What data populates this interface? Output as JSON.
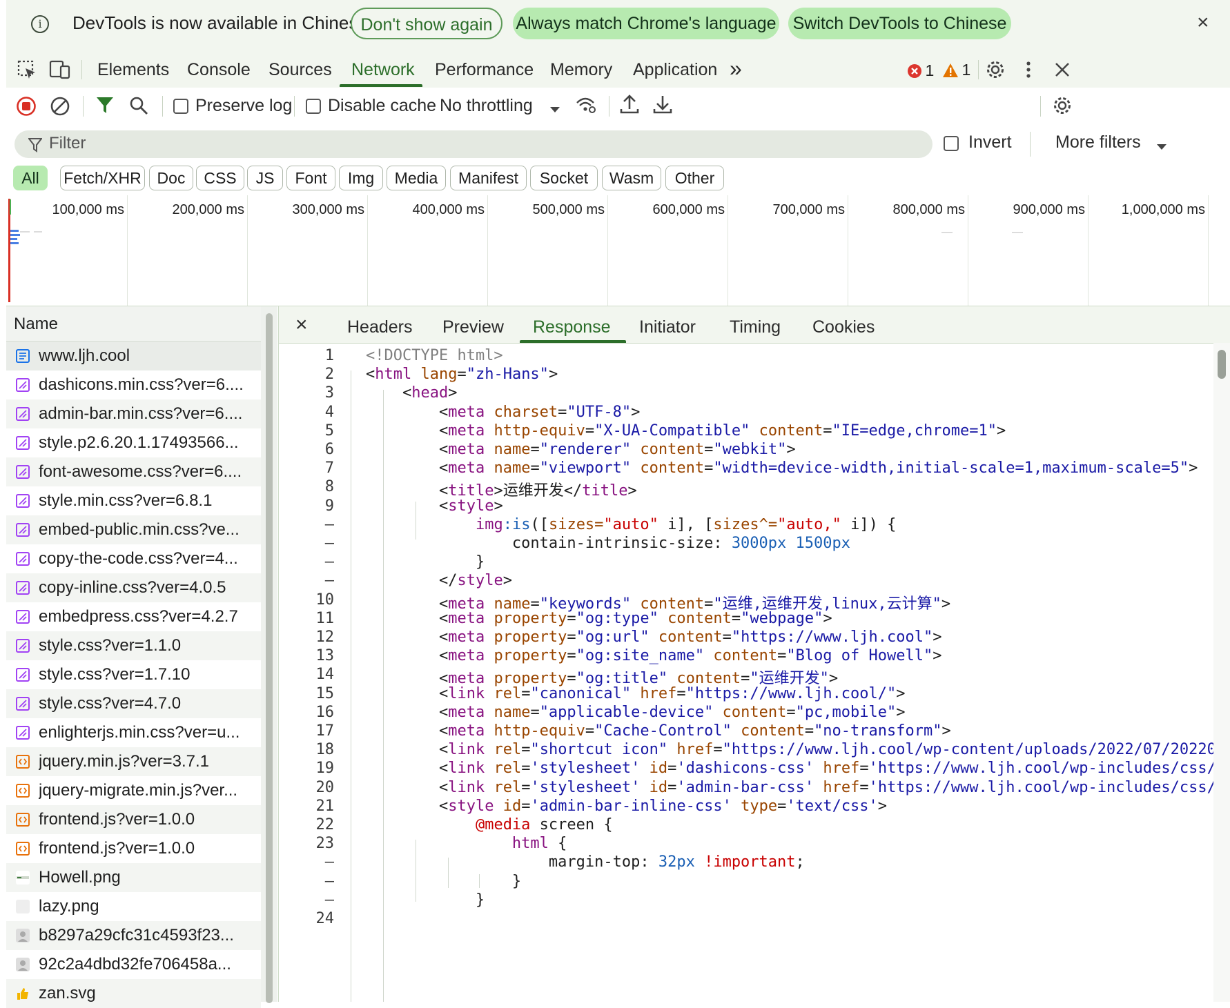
{
  "infobar": {
    "message": "DevTools is now available in Chinese",
    "btn_dont_show": "Don't show again",
    "btn_always_match": "Always match Chrome's language",
    "btn_switch": "Switch DevTools to Chinese",
    "close_glyph": "×",
    "info_glyph": "i"
  },
  "tabs": {
    "elements": "Elements",
    "console": "Console",
    "sources": "Sources",
    "network": "Network",
    "performance": "Performance",
    "memory": "Memory",
    "application": "Application",
    "more_glyph": "»",
    "errors": "1",
    "warnings": "1"
  },
  "network_toolbar": {
    "preserve_log": "Preserve log",
    "disable_cache": "Disable cache",
    "throttling": "No throttling"
  },
  "filter": {
    "placeholder": "Filter",
    "invert": "Invert",
    "more_filters": "More filters"
  },
  "chips": [
    "All",
    "Fetch/XHR",
    "Doc",
    "CSS",
    "JS",
    "Font",
    "Img",
    "Media",
    "Manifest",
    "Socket",
    "Wasm",
    "Other"
  ],
  "overview": {
    "labels": [
      "100,000 ms",
      "200,000 ms",
      "300,000 ms",
      "400,000 ms",
      "500,000 ms",
      "600,000 ms",
      "700,000 ms",
      "800,000 ms",
      "900,000 ms",
      "1,000,000 ms"
    ]
  },
  "requests": {
    "header": "Name",
    "items": [
      {
        "name": "www.ljh.cool",
        "type": "doc"
      },
      {
        "name": "dashicons.min.css?ver=6....",
        "type": "css"
      },
      {
        "name": "admin-bar.min.css?ver=6....",
        "type": "css"
      },
      {
        "name": "style.p2.6.20.1.17493566...",
        "type": "css"
      },
      {
        "name": "font-awesome.css?ver=6....",
        "type": "css"
      },
      {
        "name": "style.min.css?ver=6.8.1",
        "type": "css"
      },
      {
        "name": "embed-public.min.css?ve...",
        "type": "css"
      },
      {
        "name": "copy-the-code.css?ver=4...",
        "type": "css"
      },
      {
        "name": "copy-inline.css?ver=4.0.5",
        "type": "css"
      },
      {
        "name": "embedpress.css?ver=4.2.7",
        "type": "css"
      },
      {
        "name": "style.css?ver=1.1.0",
        "type": "css"
      },
      {
        "name": "style.css?ver=1.7.10",
        "type": "css"
      },
      {
        "name": "style.css?ver=4.7.0",
        "type": "css"
      },
      {
        "name": "enlighterjs.min.css?ver=u...",
        "type": "css"
      },
      {
        "name": "jquery.min.js?ver=3.7.1",
        "type": "js"
      },
      {
        "name": "jquery-migrate.min.js?ver...",
        "type": "js"
      },
      {
        "name": "frontend.js?ver=1.0.0",
        "type": "js"
      },
      {
        "name": "frontend.js?ver=1.0.0",
        "type": "js"
      },
      {
        "name": "Howell.png",
        "type": "img"
      },
      {
        "name": "lazy.png",
        "type": "imgblank"
      },
      {
        "name": "b8297a29cfc31c4593f23...",
        "type": "avatar"
      },
      {
        "name": "92c2a4dbd32fe706458a...",
        "type": "avatar"
      },
      {
        "name": "zan.svg",
        "type": "svg"
      }
    ]
  },
  "detail": {
    "close_glyph": "×",
    "tabs": [
      "Headers",
      "Preview",
      "Response",
      "Initiator",
      "Timing",
      "Cookies"
    ]
  },
  "code": {
    "gutter": [
      "1",
      "2",
      "3",
      "4",
      "5",
      "6",
      "7",
      "8",
      "9",
      "–",
      "–",
      "–",
      "–",
      "10",
      "11",
      "12",
      "13",
      "14",
      "15",
      "16",
      "17",
      "18",
      "19",
      "20",
      "21",
      "22",
      "23",
      "–",
      "–",
      "–",
      "24"
    ],
    "lines": [
      "<!DOCTYPE html>",
      "<html lang=\"zh-Hans\">",
      "    <head>",
      "        <meta charset=\"UTF-8\">",
      "        <meta http-equiv=\"X-UA-Compatible\" content=\"IE=edge,chrome=1\">",
      "        <meta name=\"renderer\" content=\"webkit\">",
      "        <meta name=\"viewport\" content=\"width=device-width,initial-scale=1,maximum-scale=5\">",
      "        <title>运维开发</title>",
      "        <style>",
      "            img:is([sizes=\"auto\" i], [sizes^=\"auto,\" i]) {",
      "                contain-intrinsic-size: 3000px 1500px",
      "            }",
      "        </style>",
      "        <meta name=\"keywords\" content=\"运维,运维开发,linux,云计算\">",
      "        <meta property=\"og:type\" content=\"webpage\">",
      "        <meta property=\"og:url\" content=\"https://www.ljh.cool\">",
      "        <meta property=\"og:site_name\" content=\"Blog of Howell\">",
      "        <meta property=\"og:title\" content=\"运维开发\">",
      "        <link rel=\"canonical\" href=\"https://www.ljh.cool/\">",
      "        <meta name=\"applicable-device\" content=\"pc,mobile\">",
      "        <meta http-equiv=\"Cache-Control\" content=\"no-transform\">",
      "        <link rel=\"shortcut icon\" href=\"https://www.ljh.cool/wp-content/uploads/2022/07/20220",
      "        <link rel='stylesheet' id='dashicons-css' href='https://www.ljh.cool/wp-includes/css/",
      "        <link rel='stylesheet' id='admin-bar-css' href='https://www.ljh.cool/wp-includes/css/",
      "        <style id='admin-bar-inline-css' type='text/css'>",
      "            @media screen {",
      "                html {",
      "                    margin-top: 32px !important;",
      "                }",
      "            }",
      ""
    ]
  },
  "colors": {
    "accent": "#2c6e2a",
    "chip_selected": "#b7eab0",
    "toolbar_bg": "#f2f6ef",
    "record_red": "#d93025",
    "css_icon": "#a142f4",
    "js_icon": "#e8710a",
    "doc_icon": "#1a73e8"
  }
}
